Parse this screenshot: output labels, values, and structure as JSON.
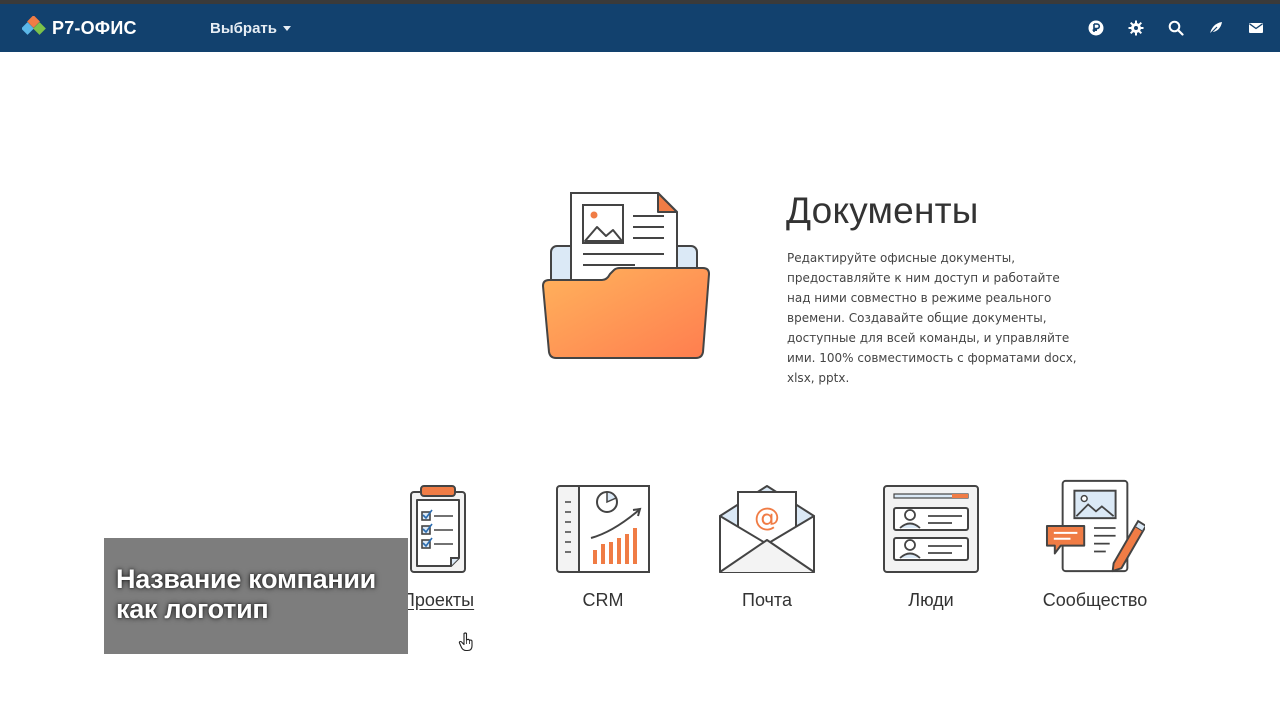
{
  "header": {
    "logo_text": "Р7-ОФИС",
    "module_select_label": "Выбрать",
    "icons": [
      "payments-icon",
      "settings-icon",
      "search-icon",
      "feed-icon",
      "mail-icon"
    ],
    "background": "#12416e"
  },
  "hero": {
    "title": "Документы",
    "description": "Редактируйте офисные документы, предоставляйте к ним доступ и работайте над ними совместно в режиме реального времени. Создавайте общие документы, доступные для всей команды, и управляйте ими. 100% совместимость с форматами docx, xlsx, pptx."
  },
  "modules": [
    {
      "label": "Проекты",
      "icon": "projects-icon"
    },
    {
      "label": "CRM",
      "icon": "crm-icon"
    },
    {
      "label": "Почта",
      "icon": "mail-module-icon"
    },
    {
      "label": "Люди",
      "icon": "people-icon"
    },
    {
      "label": "Сообщество",
      "icon": "community-icon"
    }
  ],
  "company_overlay": {
    "line1": "Название компании",
    "line2": "как логотип"
  },
  "colors": {
    "accent_orange": "#f07c45",
    "dark_outline": "#444444",
    "light_blue": "#dbe9f6"
  }
}
